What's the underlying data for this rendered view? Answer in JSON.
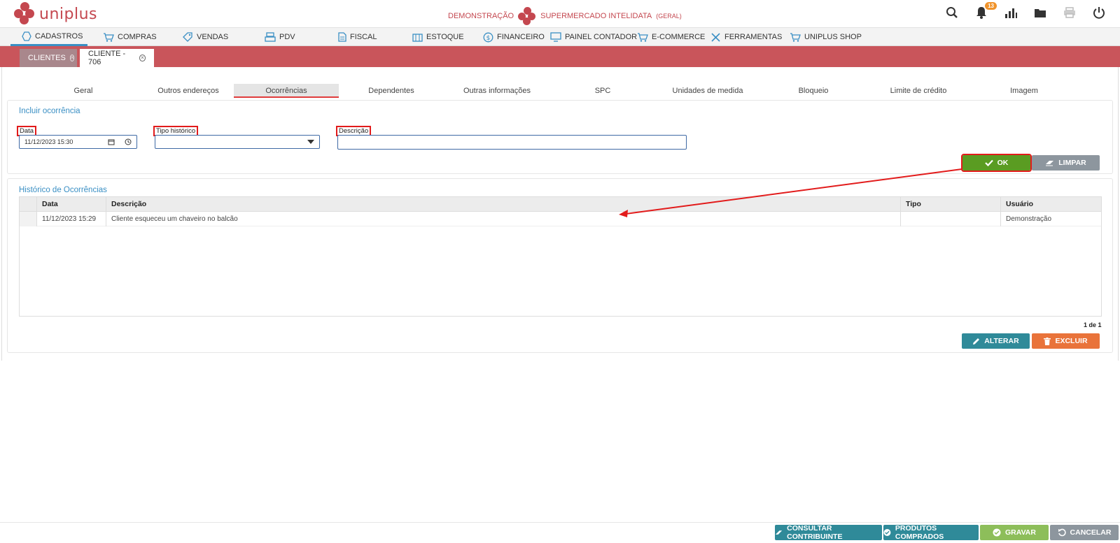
{
  "header": {
    "brand": "uniplus",
    "environment": "DEMONSTRAÇÃO",
    "company": "SUPERMERCADO INTELIDATA",
    "company_suffix": "(GERAL)",
    "notification_count": "13",
    "icons": [
      "search-icon",
      "bell-icon",
      "chart-icon",
      "folder-icon",
      "printer-icon",
      "power-icon"
    ]
  },
  "menu": {
    "items": [
      {
        "label": "CADASTROS",
        "icon": "hexagon-icon"
      },
      {
        "label": "COMPRAS",
        "icon": "cart-icon"
      },
      {
        "label": "VENDAS",
        "icon": "tag-icon"
      },
      {
        "label": "PDV",
        "icon": "register-icon"
      },
      {
        "label": "FISCAL",
        "icon": "document-icon"
      },
      {
        "label": "ESTOQUE",
        "icon": "box-icon"
      },
      {
        "label": "FINANCEIRO",
        "icon": "dollar-icon"
      },
      {
        "label": "PAINEL CONTADOR",
        "icon": "monitor-icon"
      },
      {
        "label": "E-COMMERCE",
        "icon": "cart-icon"
      },
      {
        "label": "FERRAMENTAS",
        "icon": "tools-icon"
      },
      {
        "label": "UNIPLUS SHOP",
        "icon": "cart-icon"
      }
    ]
  },
  "doc_tabs": [
    {
      "label": "CLIENTES"
    },
    {
      "label": "CLIENTE - 706"
    }
  ],
  "subtabs": [
    "Geral",
    "Outros endereços",
    "Ocorrências",
    "Dependentes",
    "Outras informações",
    "SPC",
    "Unidades de medida",
    "Bloqueio",
    "Limite de crédito",
    "Imagem"
  ],
  "form": {
    "title": "Incluir ocorrência",
    "data_label": "Data",
    "data_value": "11/12/2023 15:30",
    "tipo_label": "Tipo histórico",
    "tipo_value": "",
    "descricao_label": "Descrição",
    "descricao_value": "",
    "ok_label": "OK",
    "limpar_label": "LIMPAR"
  },
  "history": {
    "title": "Histórico de Ocorrências",
    "columns": [
      "Data",
      "Descrição",
      "Tipo",
      "Usuário"
    ],
    "rows": [
      {
        "data": "11/12/2023 15:29",
        "descricao": "Cliente esqueceu um chaveiro no balcão",
        "tipo": "",
        "usuario": "Demonstração"
      }
    ],
    "pager": "1 de 1",
    "alterar_label": "ALTERAR",
    "excluir_label": "EXCLUIR"
  },
  "footer": {
    "consultar_label": "CONSULTAR CONTRIBUINTE",
    "produtos_label": "PRODUTOS COMPRADOS",
    "gravar_label": "GRAVAR",
    "cancelar_label": "CANCELAR"
  },
  "colors": {
    "brand": "#c4474f",
    "accent": "#3a8fc4",
    "ok": "#5a9c22",
    "annotation": "#e21b1b"
  }
}
